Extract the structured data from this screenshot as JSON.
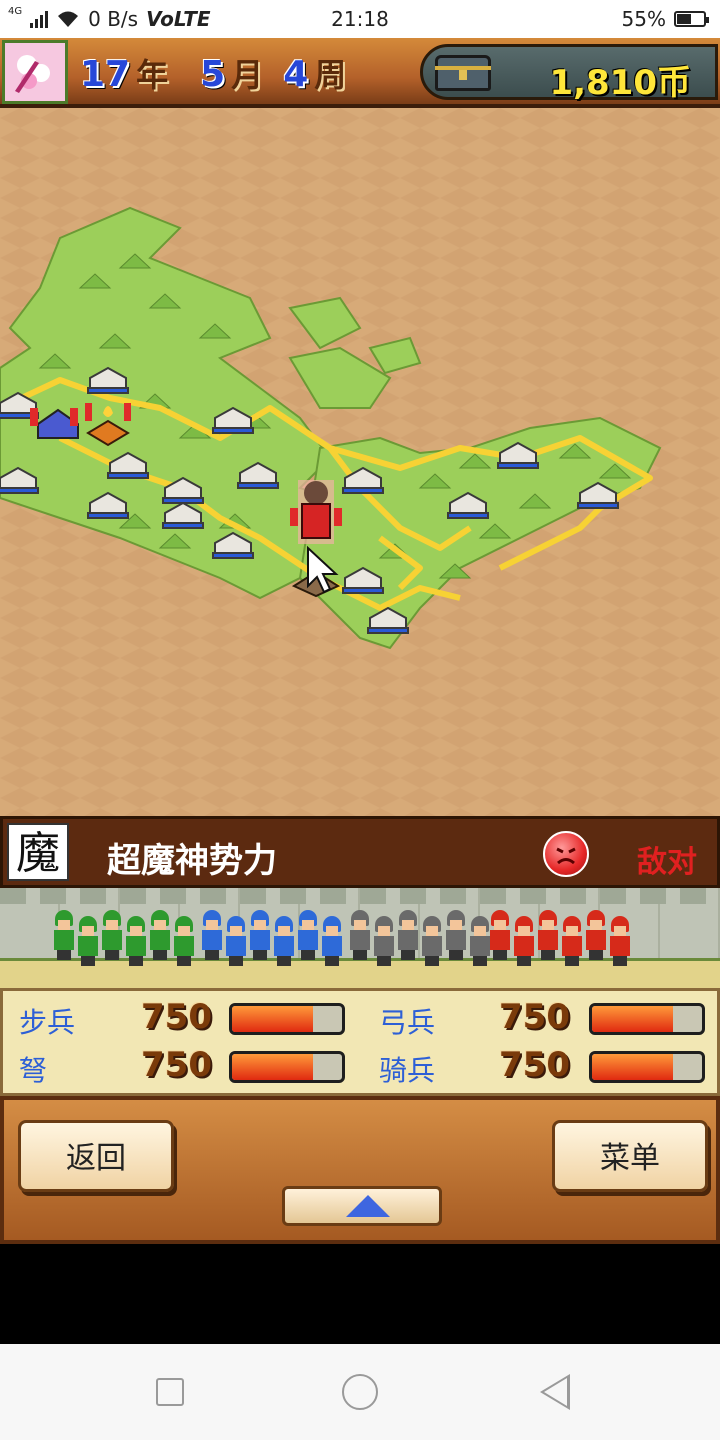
{
  "status_bar": {
    "network": "4G",
    "speed": "0 B/s",
    "volte": "VoLTE",
    "time": "21:18",
    "battery": "55%",
    "battery_level": 0.55
  },
  "top_bar": {
    "year": "17",
    "year_unit": "年",
    "month": "5",
    "month_unit": "月",
    "week": "4",
    "week_unit": "周",
    "coins": "1,810币"
  },
  "faction": {
    "icon_char": "魔",
    "name": "超魔神势力",
    "relation": "敌对"
  },
  "stats": {
    "infantry": {
      "label": "步兵",
      "value": "750",
      "level": 0.74
    },
    "archer": {
      "label": "弓兵",
      "value": "750",
      "level": 0.74
    },
    "crossbow": {
      "label": "弩",
      "value": "750",
      "level": 0.74
    },
    "cavalry": {
      "label": "骑兵",
      "value": "750",
      "level": 0.74
    }
  },
  "buttons": {
    "back": "返回",
    "menu": "菜单"
  },
  "colors": {
    "accent_blue": "#2747d8",
    "coin_yellow": "#ffe63a",
    "hostile_red": "#e02020",
    "stat_blue": "#2d5fd6"
  },
  "icons": [
    "signal-icon",
    "wifi-icon",
    "battery-icon",
    "faction-emblem-icon",
    "treasure-chest-icon",
    "angry-face-icon",
    "up-arrow-icon",
    "nav-square-icon",
    "nav-home-icon",
    "nav-back-icon"
  ]
}
